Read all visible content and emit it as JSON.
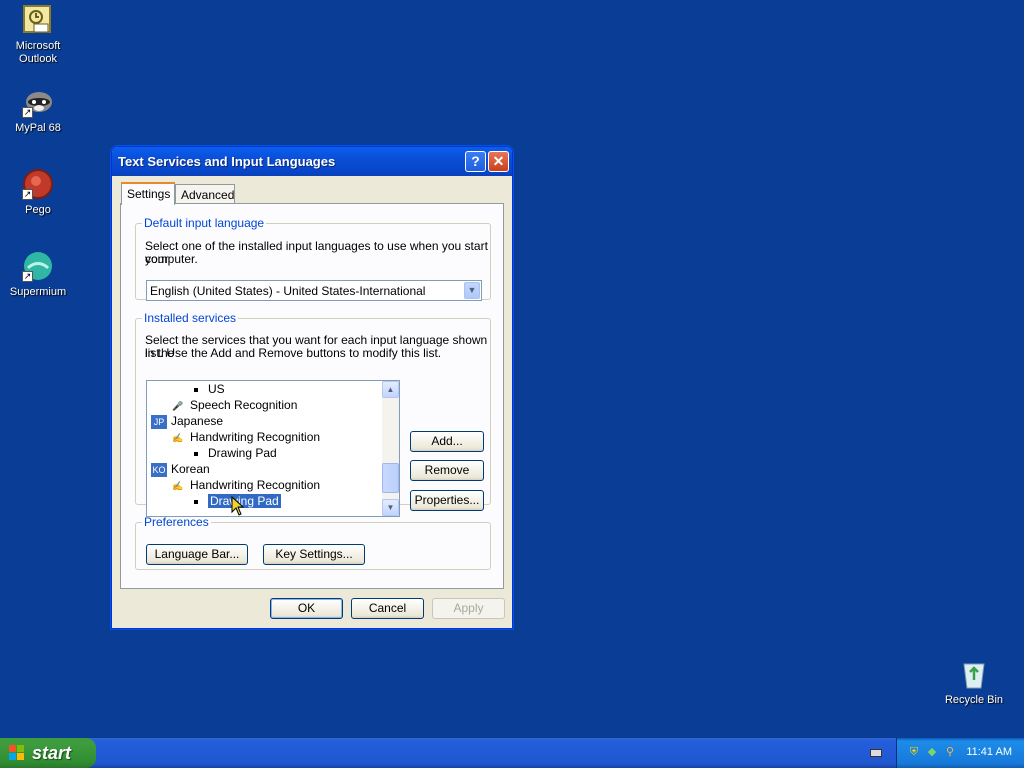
{
  "desktop": {
    "icons": [
      {
        "label": "Microsoft Outlook",
        "icon": "outlook-icon"
      },
      {
        "label": "MyPal 68",
        "icon": "mypal-raccoon-icon"
      },
      {
        "label": "Pego",
        "icon": "pego-icon"
      },
      {
        "label": "Supermium",
        "icon": "supermium-icon"
      },
      {
        "label": "Recycle Bin",
        "icon": "recycle-bin-icon"
      }
    ]
  },
  "dialog": {
    "title": "Text Services and Input Languages",
    "help_glyph": "?",
    "close_glyph": "✕",
    "tabs": [
      {
        "label": "Settings",
        "active": true
      },
      {
        "label": "Advanced",
        "active": false
      }
    ],
    "default_lang": {
      "legend": "Default input language",
      "description_line1": "Select one of the installed input languages to use when you start your",
      "description_line2": "computer.",
      "selected": "English (United States) - United States-International"
    },
    "installed": {
      "legend": "Installed services",
      "description_line1": "Select the services that you want for each input language shown in the",
      "description_line2": "list. Use the Add and Remove buttons to modify this list.",
      "items": [
        {
          "kind": "bullet",
          "text": "US"
        },
        {
          "kind": "service",
          "icon": "microphone-icon",
          "text": "Speech Recognition"
        },
        {
          "kind": "language",
          "badge": "JP",
          "text": "Japanese"
        },
        {
          "kind": "service",
          "icon": "pen-icon",
          "text": "Handwriting Recognition"
        },
        {
          "kind": "bullet",
          "text": "Drawing Pad"
        },
        {
          "kind": "language",
          "badge": "KO",
          "text": "Korean"
        },
        {
          "kind": "service",
          "icon": "pen-icon",
          "text": "Handwriting Recognition"
        },
        {
          "kind": "bullet",
          "text": "Drawing Pad",
          "selected": true
        }
      ],
      "buttons": {
        "add": "Add...",
        "remove": "Remove",
        "properties": "Properties..."
      }
    },
    "preferences": {
      "legend": "Preferences",
      "language_bar": "Language Bar...",
      "key_settings": "Key Settings..."
    },
    "footer": {
      "ok": "OK",
      "cancel": "Cancel",
      "apply": "Apply"
    }
  },
  "taskbar": {
    "start_label": "start",
    "clock": "11:41 AM"
  }
}
